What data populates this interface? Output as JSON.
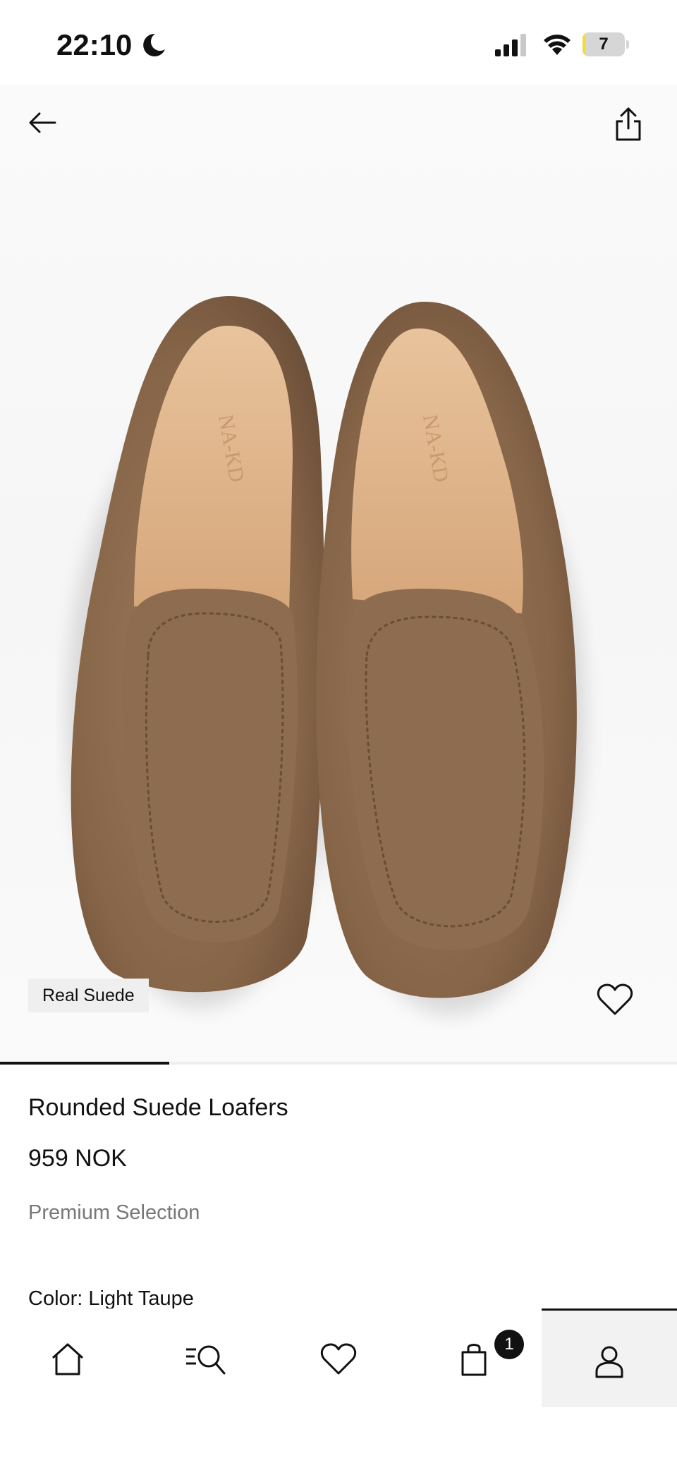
{
  "status_bar": {
    "time": "22:10",
    "battery_level": "7",
    "battery_fraction": 0.07,
    "icons": [
      "moon-icon",
      "signal-icon",
      "wifi-icon",
      "battery-icon"
    ]
  },
  "header": {
    "back_icon": "arrow-left-icon",
    "share_icon": "share-icon"
  },
  "product": {
    "image": "pair of light taupe suede loafers with NAKD insole branding, top view",
    "insole_brand": "NA-KD",
    "badge": "Real Suede",
    "title": "Rounded Suede Loafers",
    "price": "959 NOK",
    "subtitle": "Premium Selection",
    "color_label": "Color: Light Taupe",
    "gallery_progress_fraction": 0.25
  },
  "bottom_nav": {
    "items": [
      {
        "name": "home",
        "icon": "home-icon"
      },
      {
        "name": "search",
        "icon": "menu-search-icon"
      },
      {
        "name": "wishlist",
        "icon": "heart-icon"
      },
      {
        "name": "cart",
        "icon": "shopping-bag-icon",
        "badge": "1"
      },
      {
        "name": "account",
        "icon": "user-icon",
        "active": true
      }
    ]
  },
  "colors": {
    "text": "#111111",
    "muted": "#777777",
    "suede": "#8b6a4e",
    "insole": "#e0b58c",
    "badge_bg": "#efefef"
  }
}
